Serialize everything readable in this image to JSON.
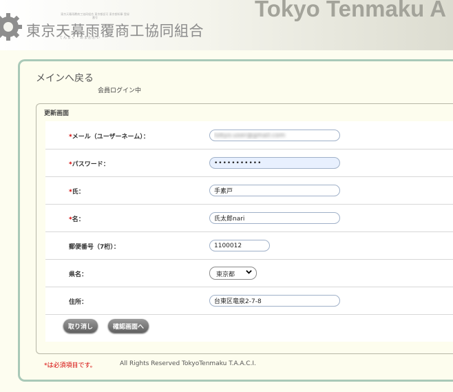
{
  "header": {
    "org_name": "東京天幕雨覆商工協同組合",
    "org_small_text": "東京天幕雨覆商工協同組合 東京都認可 東京都知事 登録番号",
    "org_ruby": "てんまく　あまおおい",
    "brand_en": "Tokyo Tenmaku A"
  },
  "nav": {
    "back_label": "メインへ戻る",
    "login_status": "会員ログイン中"
  },
  "form": {
    "legend": "更新画面",
    "required_mark": "*",
    "fields": [
      {
        "label": "メール（ユーザーネーム）：",
        "required": true,
        "value": "tokyo.user@gmail.com"
      },
      {
        "label": "パスワード：",
        "required": true,
        "value": "•••••••••••"
      },
      {
        "label": "氏：",
        "required": true,
        "value": "手素戸"
      },
      {
        "label": "名：",
        "required": true,
        "value": "氏太郎nari"
      },
      {
        "label": "郵便番号（7桁）：",
        "required": false,
        "value": "1100012"
      },
      {
        "label": "県名：",
        "required": false,
        "value": "東京都"
      },
      {
        "label": "住所：",
        "required": false,
        "value": "台東区竜泉2-7-8"
      }
    ],
    "cancel_label": "取り消し",
    "confirm_label": "確認画面へ"
  },
  "footer": {
    "required_note": "*は必須項目です。",
    "copyright": "All Rights Reserved TokyoTenmaku T.A.A.C.I."
  },
  "colors": {
    "required": "#d40000",
    "panel_border": "#a9c9b8",
    "button": "#707070"
  }
}
